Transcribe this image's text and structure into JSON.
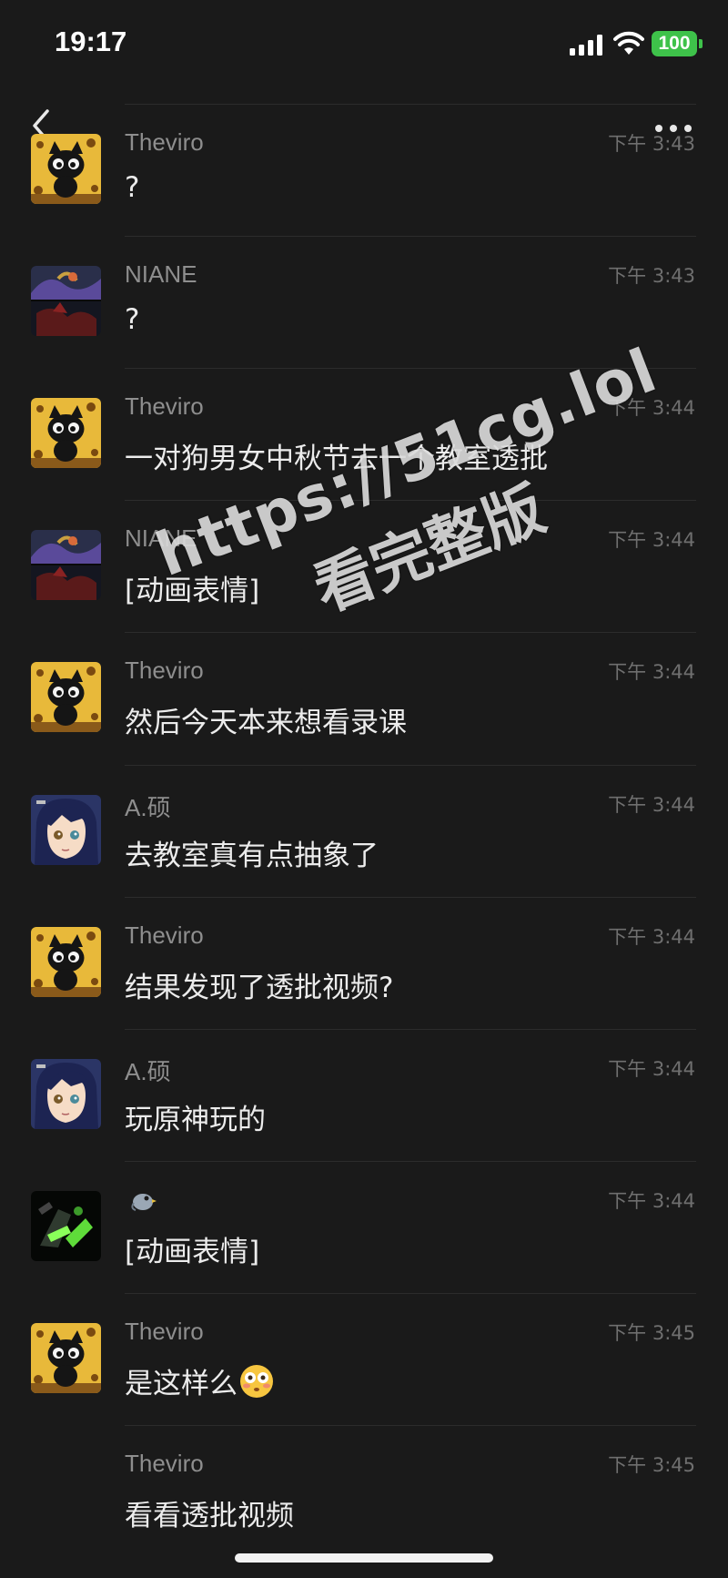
{
  "status_bar": {
    "time": "19:17",
    "battery": "100",
    "battery_color": "#3ec24a"
  },
  "nav": {
    "back_icon": "chevron-left-icon",
    "more_icon": "ellipsis-icon"
  },
  "messages": [
    {
      "sender": "Theviro",
      "time": "下午 3:43",
      "text": "?",
      "avatar": "black-cat"
    },
    {
      "sender": "NIANE",
      "time": "下午 3:43",
      "text": "?",
      "avatar": "dragon-art"
    },
    {
      "sender": "Theviro",
      "time": "下午 3:44",
      "text": "一对狗男女中秋节去一个教室透批",
      "avatar": "black-cat"
    },
    {
      "sender": "NIANE",
      "time": "下午 3:44",
      "text": "[动画表情]",
      "avatar": "dragon-art"
    },
    {
      "sender": "Theviro",
      "time": "下午 3:44",
      "text": "然后今天本来想看录课",
      "avatar": "black-cat"
    },
    {
      "sender": "A.硕",
      "time": "下午 3:44",
      "text": "去教室真有点抽象了",
      "avatar": "anime-girl"
    },
    {
      "sender": "Theviro",
      "time": "下午 3:44",
      "text": "结果发现了透批视频?",
      "avatar": "black-cat"
    },
    {
      "sender": "A.硕",
      "time": "下午 3:44",
      "text": "玩原神玩的",
      "avatar": "anime-girl"
    },
    {
      "sender": "",
      "time": "下午 3:44",
      "text": "[动画表情]",
      "avatar": "green-robot",
      "sender_icon": "bird-icon"
    },
    {
      "sender": "Theviro",
      "time": "下午 3:45",
      "text": "是这样么",
      "avatar": "black-cat",
      "emoji": "flushed-face-icon"
    },
    {
      "sender": "Theviro",
      "time": "下午 3:45",
      "text": "看看透批视频",
      "avatar": "none"
    }
  ],
  "watermark": {
    "url": "https://51cg.lol",
    "sub": "看完整版"
  },
  "colors": {
    "background": "#1a1a1a",
    "sender": "#8e8e8e",
    "message_text": "#ececec",
    "timestamp": "#6f6f6f",
    "divider": "#2c2c2c"
  }
}
